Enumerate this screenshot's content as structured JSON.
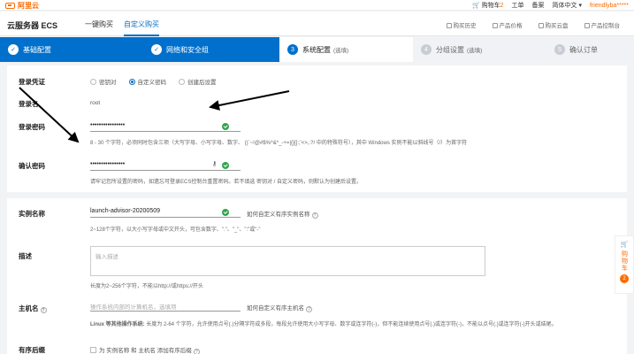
{
  "topbar": {
    "logo_text": "阿里云",
    "cart_label": "购物车",
    "cart_count": "2",
    "ticket": "工单",
    "record": "备案",
    "lang": "简体中文 ▾",
    "user": "friendlyba*****"
  },
  "nav": {
    "product_title": "云服务器 ECS",
    "tabs": [
      "一键购买",
      "自定义购买"
    ],
    "right_links": [
      "购买历史",
      "产品价格",
      "购买云盘",
      "产品控制台"
    ]
  },
  "steps": [
    {
      "num": "✓",
      "label": "基础配置",
      "sub": ""
    },
    {
      "num": "✓",
      "label": "网络和安全组",
      "sub": ""
    },
    {
      "num": "3",
      "label": "系统配置",
      "sub": "(选填)"
    },
    {
      "num": "4",
      "label": "分组设置",
      "sub": "(选填)"
    },
    {
      "num": "5",
      "label": "确认订单",
      "sub": ""
    }
  ],
  "credentials": {
    "label": "登录凭证",
    "options": [
      "密钥对",
      "自定义密码",
      "创建后设置"
    ],
    "selected": "自定义密码"
  },
  "login_name": {
    "label": "登录名",
    "value": "root"
  },
  "login_password": {
    "label": "登录密码",
    "value": "••••••••••••••••",
    "hint": "8 - 30 个字符，必须同时包含三项（大写字母、小写字母、数字、 ()`~!@#$%^&*_-+=|{}[]:;'<>,.?/ 中的特殊符号），其中 Windows 实例不能以斜线号（/）为首字符"
  },
  "confirm_password": {
    "label": "确认密码",
    "value": "••••••••••••••••",
    "hint": "请牢记您所设置的密码，如遗忘可登录ECS控制台重置密码。若不填选 密钥对 / 自定义密码，则默认为创建后设置。"
  },
  "instance_name": {
    "label": "实例名称",
    "value": "launch-advisor-20200509",
    "side": "如何自定义有序实例名称",
    "hint": "2~128个字符，以大小写字母或中文开头，可包含数字、\".\"、\"_\"、\":\"或\"-\""
  },
  "description": {
    "label": "描述",
    "placeholder": "输入描述",
    "hint": "长度为2~256个字符，不能以http://或https://开头"
  },
  "hostname": {
    "label": "主机名",
    "placeholder": "操作系统内部的计算机名，选填项",
    "side": "如何自定义有序主机名",
    "hint_bold": "Linux 等其他操作系统:",
    "hint": "长度为 2-64 个字符，允许使用点号(.)分隔字符成多段，每段允许使用大小写字母、数字或连字符(-)，但不能连续使用点号(.)或连字符(-)，不能以点号(.)或连字符(-)开头或结尾。"
  },
  "ordered_suffix": {
    "label": "有序后缀",
    "text": "为 实例名称 和 主机名 添加有序后缀"
  },
  "float_cart": {
    "label": "购物车",
    "count": "2"
  }
}
